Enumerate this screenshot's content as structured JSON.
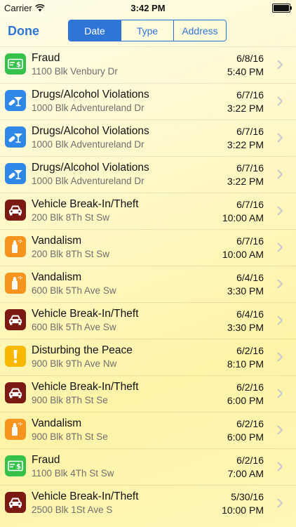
{
  "status_bar": {
    "carrier": "Carrier",
    "time": "3:42 PM"
  },
  "nav": {
    "done_label": "Done",
    "segments": [
      {
        "label": "Date",
        "selected": true
      },
      {
        "label": "Type",
        "selected": false
      },
      {
        "label": "Address",
        "selected": false
      }
    ]
  },
  "colors": {
    "accent": "#2f75d6",
    "fraud_icon": "#36c24a",
    "drugs_icon": "#2f87e8",
    "vehicle_icon": "#7a1a12",
    "vandalism_icon": "#f7941d",
    "disturbing_icon": "#f9b800"
  },
  "incidents": [
    {
      "type": "fraud",
      "icon": "cash-icon",
      "title": "Fraud",
      "address": "1100 Blk Venbury Dr",
      "date": "6/8/16",
      "time": "5:40 PM"
    },
    {
      "type": "drugs",
      "icon": "cocktail-pill-icon",
      "title": "Drugs/Alcohol Violations",
      "address": "1000 Blk Adventureland Dr",
      "date": "6/7/16",
      "time": "3:22 PM"
    },
    {
      "type": "drugs",
      "icon": "cocktail-pill-icon",
      "title": "Drugs/Alcohol Violations",
      "address": "1000 Blk Adventureland Dr",
      "date": "6/7/16",
      "time": "3:22 PM"
    },
    {
      "type": "drugs",
      "icon": "cocktail-pill-icon",
      "title": "Drugs/Alcohol Violations",
      "address": "1000 Blk Adventureland Dr",
      "date": "6/7/16",
      "time": "3:22 PM"
    },
    {
      "type": "vehicle",
      "icon": "car-icon",
      "title": "Vehicle Break-In/Theft",
      "address": "200 Blk 8Th St Sw",
      "date": "6/7/16",
      "time": "10:00 AM"
    },
    {
      "type": "vandalism",
      "icon": "spray-can-icon",
      "title": "Vandalism",
      "address": "200 Blk 8Th St Sw",
      "date": "6/7/16",
      "time": "10:00 AM"
    },
    {
      "type": "vandalism",
      "icon": "spray-can-icon",
      "title": "Vandalism",
      "address": "600 Blk 5Th Ave Sw",
      "date": "6/4/16",
      "time": "3:30 PM"
    },
    {
      "type": "vehicle",
      "icon": "car-icon",
      "title": "Vehicle Break-In/Theft",
      "address": "600 Blk 5Th Ave Sw",
      "date": "6/4/16",
      "time": "3:30 PM"
    },
    {
      "type": "disturbing",
      "icon": "exclamation-icon",
      "title": "Disturbing the Peace",
      "address": "900 Blk 9Th Ave Nw",
      "date": "6/2/16",
      "time": "8:10 PM"
    },
    {
      "type": "vehicle",
      "icon": "car-icon",
      "title": "Vehicle Break-In/Theft",
      "address": "900 Blk 8Th St Se",
      "date": "6/2/16",
      "time": "6:00 PM"
    },
    {
      "type": "vandalism",
      "icon": "spray-can-icon",
      "title": "Vandalism",
      "address": "900 Blk 8Th St Se",
      "date": "6/2/16",
      "time": "6:00 PM"
    },
    {
      "type": "fraud",
      "icon": "cash-icon",
      "title": "Fraud",
      "address": "1100 Blk 4Th St Sw",
      "date": "6/2/16",
      "time": "7:00 AM"
    },
    {
      "type": "vehicle",
      "icon": "car-icon",
      "title": "Vehicle Break-In/Theft",
      "address": "2500 Blk 1St Ave S",
      "date": "5/30/16",
      "time": "10:00 PM"
    }
  ]
}
